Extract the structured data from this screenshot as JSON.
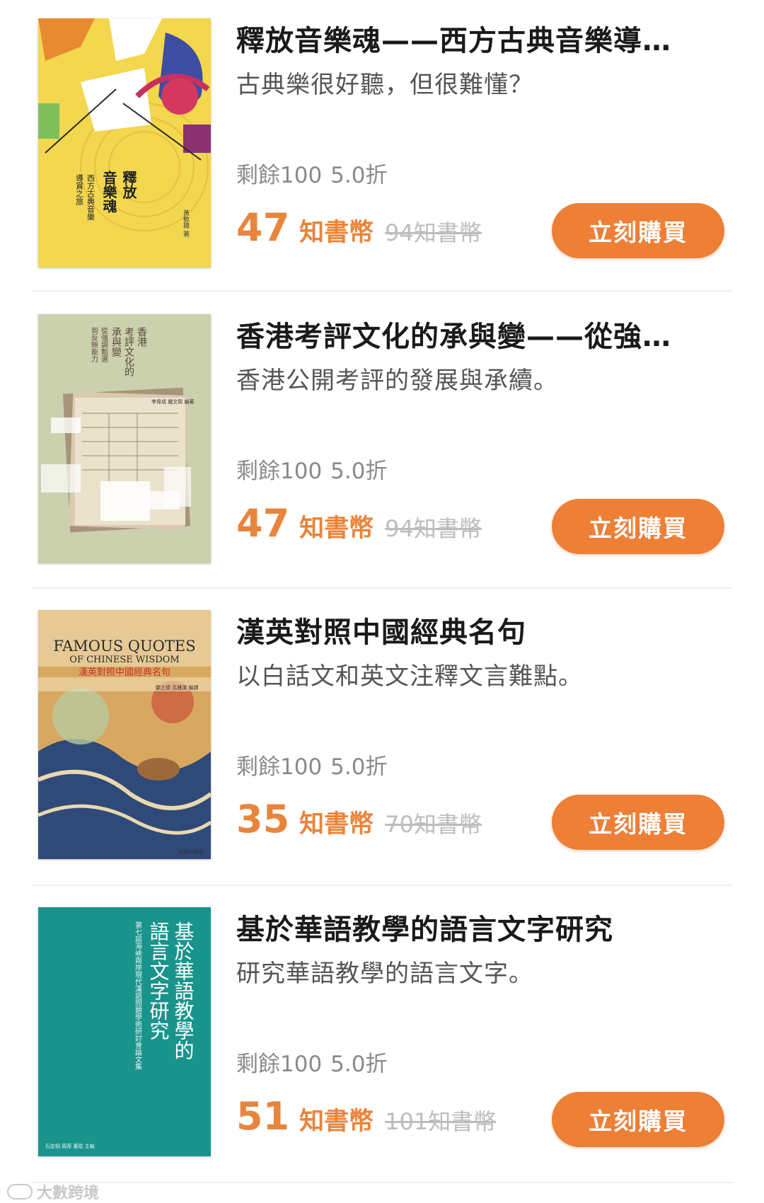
{
  "books": [
    {
      "title": "釋放音樂魂——西方古典音樂導…",
      "subtitle": "古典樂很好聽，但很難懂？",
      "stock": "剩餘100",
      "discount": "5.0折",
      "price": "47",
      "unit": "知書幣",
      "original_price": "94知書幣",
      "buy_label": "立刻購買",
      "cover": {
        "title_lines": [
          "釋放",
          "音樂魂"
        ],
        "subtitle_lines": [
          "西方古典音樂",
          "導賞之旅"
        ],
        "author": "黃敏聰 著",
        "colors": [
          "#f1d44a",
          "#c8315d",
          "#3a4c9a",
          "#e45c2d"
        ]
      }
    },
    {
      "title": "香港考評文化的承與變——從強…",
      "subtitle": "香港公開考評的發展與承續。",
      "stock": "剩餘100",
      "discount": "5.0折",
      "price": "47",
      "unit": "知書幣",
      "original_price": "94知書幣",
      "buy_label": "立刻購買",
      "cover": {
        "title_lines": [
          "香港",
          "考評文化的",
          "承與變"
        ],
        "subtitle_lines": [
          "從強調甄選",
          "到反映能力"
        ],
        "author": "李偉成 鍾文熙 編著",
        "colors": [
          "#cbcfac",
          "#e8e1cf",
          "#b09c7d"
        ]
      }
    },
    {
      "title": "漢英對照中國經典名句",
      "subtitle": "以白話文和英文注釋文言難點。",
      "stock": "剩餘100",
      "discount": "5.0折",
      "price": "35",
      "unit": "知書幣",
      "original_price": "70知書幣",
      "buy_label": "立刻購買",
      "cover": {
        "en_line1": "FAMOUS QUOTES",
        "en_line2": "OF CHINESE WISDOM",
        "cn_title": "漢英對照中國經典名句",
        "author": "鄭土德 呂雅潔 編譯",
        "publisher": "商務印書館",
        "colors": [
          "#d9a55a",
          "#2f4a78",
          "#e5c98a",
          "#8a3b1f"
        ]
      }
    },
    {
      "title": "基於華語教學的語言文字研究",
      "subtitle": "研究華語教學的語言文字。",
      "stock": "剩餘100",
      "discount": "5.0折",
      "price": "51",
      "unit": "知書幣",
      "original_price": "101知書幣",
      "buy_label": "立刻購買",
      "cover": {
        "title_lines": [
          "基於華語教學的",
          "語言文字研究"
        ],
        "subtitle_lines": [
          "第七屆海峽兩岸現代漢語問題學術研討會論文集"
        ],
        "author": "石定栩 周荐 董琨 主編",
        "colors": [
          "#1a9a92",
          "#ffffff"
        ]
      }
    }
  ],
  "watermark": "大數跨境"
}
